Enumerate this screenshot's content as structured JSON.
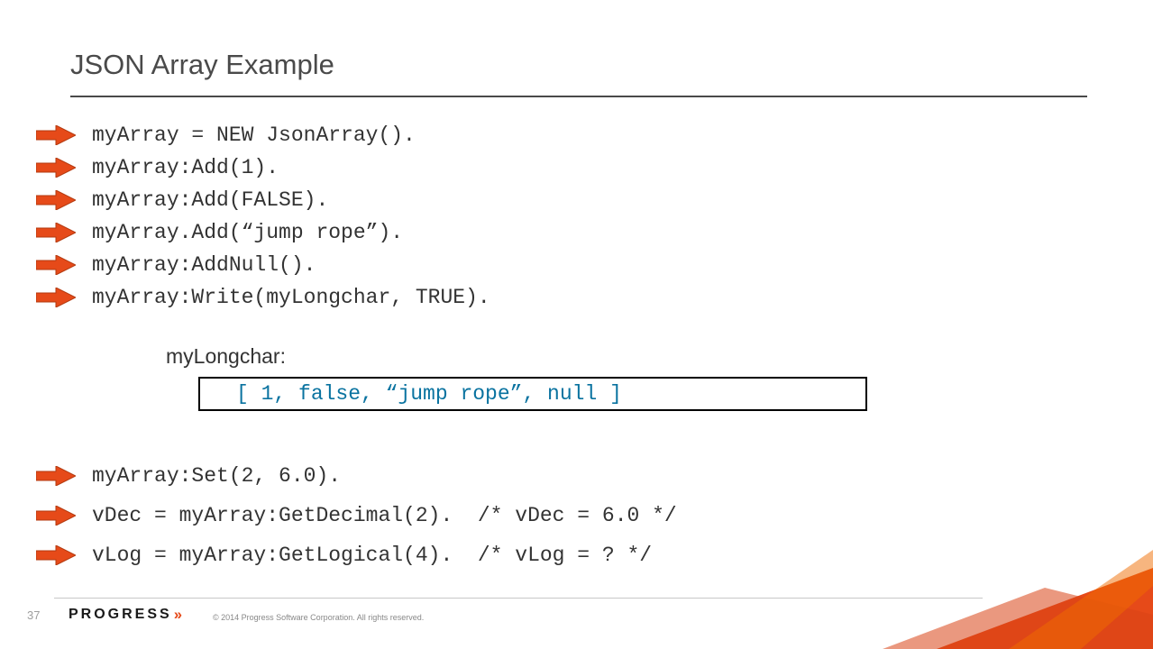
{
  "title": "JSON Array Example",
  "code1": [
    "myArray = NEW JsonArray().",
    "myArray:Add(1).",
    "myArray:Add(FALSE).",
    "myArray.Add(“jump rope”).",
    "myArray:AddNull().",
    "myArray:Write(myLongchar, TRUE)."
  ],
  "output_label": "myLongchar:",
  "output_box": "[ 1, false, “jump rope”, null ]",
  "code2": [
    "myArray:Set(2, 6.0).",
    "vDec = myArray:GetDecimal(2).  /* vDec = 6.0 */",
    "vLog = myArray:GetLogical(4).  /* vLog = ? */"
  ],
  "page_number": "37",
  "logo_text": "PROGRESS",
  "copyright": "© 2014 Progress Software Corporation. All rights reserved."
}
